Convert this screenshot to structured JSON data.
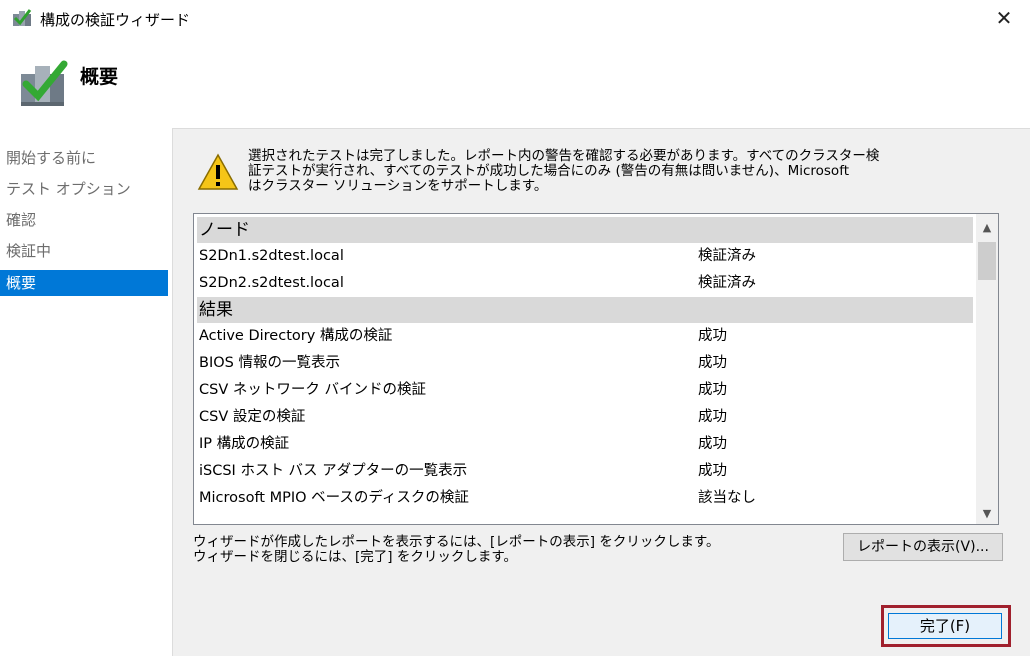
{
  "window": {
    "title": "構成の検証ウィザード"
  },
  "header": {
    "title": "概要"
  },
  "nav": {
    "items": [
      "開始する前に",
      "テスト オプション",
      "確認",
      "検証中",
      "概要"
    ],
    "active": 4
  },
  "summary": {
    "lines": [
      "選択されたテストは完了しました。レポート内の警告を確認する必要があります。すべてのクラスター検",
      "証テストが実行され、すべてのテストが成功した場合にのみ (警告の有無は問いません)、Microsoft",
      "はクラスター ソリューションをサポートします。"
    ]
  },
  "list": {
    "nodes_header": "ノード",
    "nodes": [
      {
        "name": "S2Dn1.s2dtest.local",
        "status": "検証済み"
      },
      {
        "name": "S2Dn2.s2dtest.local",
        "status": "検証済み"
      }
    ],
    "results_header": "結果",
    "results": [
      {
        "name": "Active Directory 構成の検証",
        "status": "成功"
      },
      {
        "name": "BIOS 情報の一覧表示",
        "status": "成功"
      },
      {
        "name": "CSV ネットワーク バインドの検証",
        "status": "成功"
      },
      {
        "name": "CSV 設定の検証",
        "status": "成功"
      },
      {
        "name": "IP 構成の検証",
        "status": "成功"
      },
      {
        "name": "iSCSI ホスト バス アダプターの一覧表示",
        "status": "成功"
      },
      {
        "name": "Microsoft MPIO ベースのディスクの検証",
        "status": "該当なし"
      }
    ]
  },
  "footer": {
    "lines": [
      "ウィザードが作成したレポートを表示するには、[レポートの表示] をクリックします。",
      "ウィザードを閉じるには、[完了] をクリックします。"
    ],
    "report_button": "レポートの表示(V)...",
    "finish_button": "完了(F)"
  },
  "colors": {
    "accent": "#0078d7",
    "highlight": "#a0202d"
  },
  "icons": {
    "app": "wizard-check-icon",
    "header": "wizard-check-icon",
    "warning": "warning-icon",
    "close": "close-icon"
  }
}
